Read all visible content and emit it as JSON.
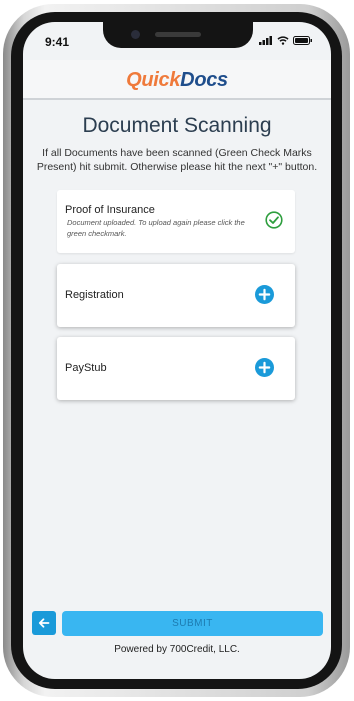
{
  "status_bar": {
    "time": "9:41"
  },
  "app": {
    "logo_part1": "Quick",
    "logo_part2": "Docs"
  },
  "page": {
    "title": "Document Scanning",
    "instructions": "If all Documents have been scanned (Green Check Marks Present) hit submit. Otherwise please hit the next \"+\" button."
  },
  "documents": [
    {
      "label": "Proof of Insurance",
      "note": "Document uploaded. To upload again please click the green checkmark.",
      "status_icon": "check-circle-icon"
    },
    {
      "label": "Registration",
      "status_icon": "plus-circle-icon"
    },
    {
      "label": "PayStub",
      "status_icon": "plus-circle-icon"
    }
  ],
  "actions": {
    "submit_label": "SUBMIT",
    "back_icon": "arrow-left-icon"
  },
  "footer": {
    "text": "Powered by 700Credit, LLC."
  },
  "colors": {
    "accent": "#1a9ad9",
    "submit": "#39b6f1",
    "check": "#2e9e3e",
    "logo_orange": "#ef7a3b",
    "logo_blue": "#1f4e8c",
    "title": "#2c3e50"
  }
}
